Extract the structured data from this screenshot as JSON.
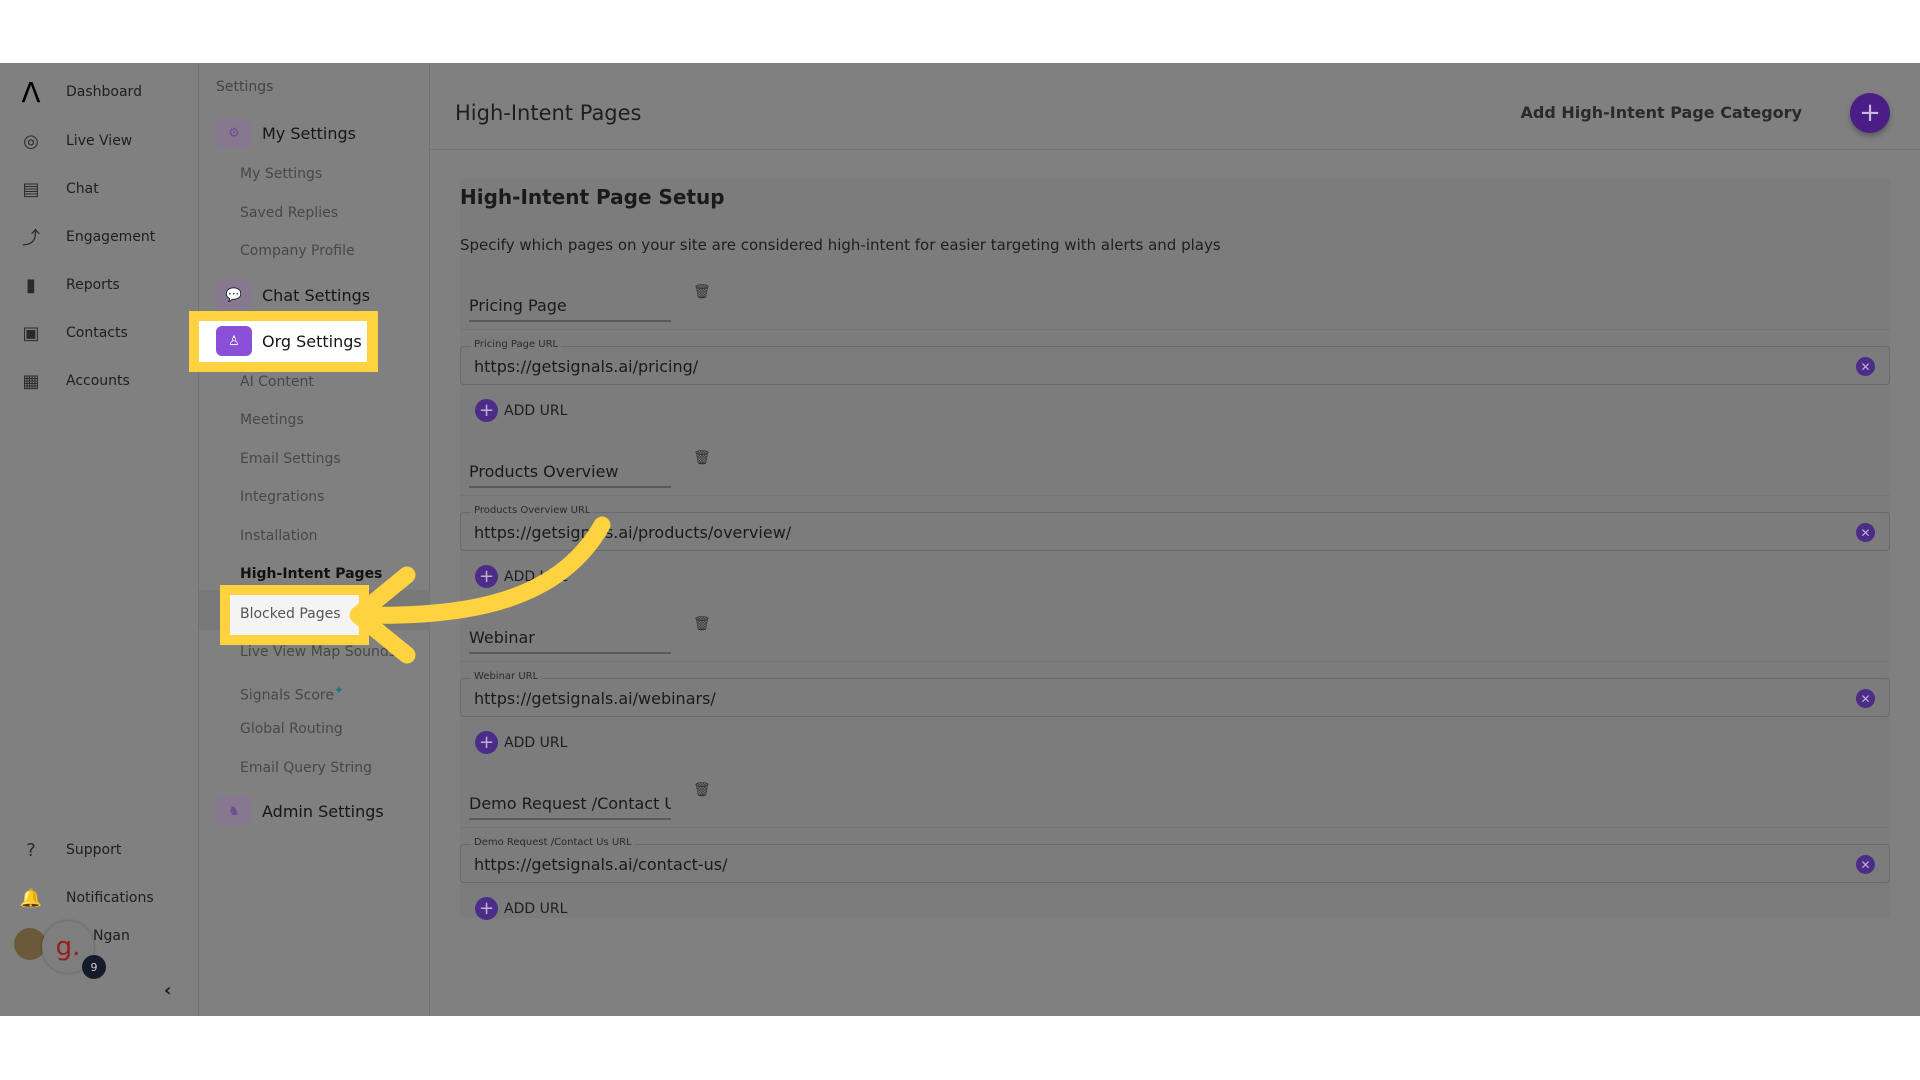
{
  "nav": {
    "items": [
      {
        "label": "Dashboard",
        "icon": "logo-icon"
      },
      {
        "label": "Live View",
        "icon": "globe-search-icon"
      },
      {
        "label": "Chat",
        "icon": "chat-icon"
      },
      {
        "label": "Engagement",
        "icon": "engagement-icon"
      },
      {
        "label": "Reports",
        "icon": "bar-chart-icon"
      },
      {
        "label": "Contacts",
        "icon": "contacts-icon"
      },
      {
        "label": "Accounts",
        "icon": "building-icon"
      }
    ],
    "support": "Support",
    "notifications": "Notifications",
    "user_name": "Ngan",
    "badge_count": "9",
    "brand_letter": "g."
  },
  "settings": {
    "header": "Settings",
    "my_settings": "My Settings",
    "my_items": [
      "My Settings",
      "Saved Replies",
      "Company Profile"
    ],
    "chat_settings": "Chat Settings",
    "org_settings": "Org Settings",
    "org_items": [
      "AI Content",
      "Meetings",
      "Email Settings",
      "Integrations",
      "Installation",
      "High-Intent Pages",
      "Blocked Pages",
      "Live View Map Sounds",
      "Signals Score",
      "Global Routing",
      "Email Query String"
    ],
    "admin_settings": "Admin Settings"
  },
  "main": {
    "title": "High-Intent Pages",
    "add_category": "Add High-Intent Page Category",
    "card_title": "High-Intent Page Setup",
    "description": "Specify which pages on your site are considered high-intent for easier targeting with alerts and plays",
    "add_url_label": "ADD URL",
    "groups": [
      {
        "name": "Pricing Page",
        "url_label": "Pricing Page URL",
        "url": "https://getsignals.ai/pricing/"
      },
      {
        "name": "Products Overview",
        "url_label": "Products Overview URL",
        "url": "https://getsignals.ai/products/overview/"
      },
      {
        "name": "Webinar",
        "url_label": "Webinar URL",
        "url": "https://getsignals.ai/webinars/"
      },
      {
        "name": "Demo Request /Contact Us",
        "url_label": "Demo Request /Contact Us URL",
        "url": "https://getsignals.ai/contact-us/"
      }
    ]
  },
  "colors": {
    "accent": "#7e3ddb",
    "highlight": "#FFD23F",
    "overlay": "#808080"
  }
}
